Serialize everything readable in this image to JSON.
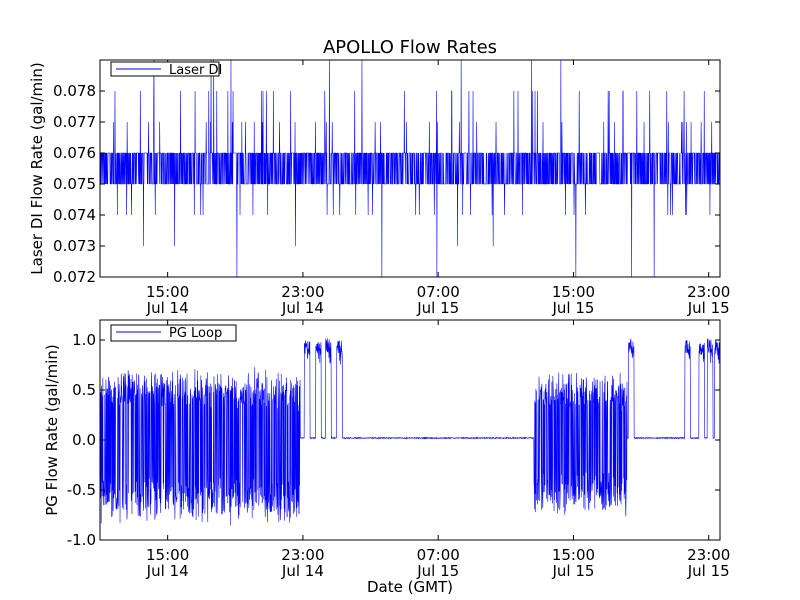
{
  "chart_data": [
    {
      "type": "line",
      "title": "APOLLO Flow Rates",
      "xlabel": "",
      "ylabel": "Laser DI Flow Rate (gal/min)",
      "x_range": [
        "2014-07-14 11:00",
        "2014-07-15 23:40"
      ],
      "ylim": [
        0.072,
        0.079
      ],
      "y_ticks": [
        0.072,
        0.073,
        0.074,
        0.075,
        0.076,
        0.077,
        0.078
      ],
      "y_tick_labels": [
        "0.072",
        "0.073",
        "0.074",
        "0.075",
        "0.076",
        "0.077",
        "0.078"
      ],
      "x_ticks": [
        {
          "value": "2014-07-14 15:00",
          "time": "15:00",
          "date": "Jul 14"
        },
        {
          "value": "2014-07-14 23:00",
          "time": "23:00",
          "date": "Jul 14"
        },
        {
          "value": "2014-07-15 07:00",
          "time": "07:00",
          "date": "Jul 15"
        },
        {
          "value": "2014-07-15 15:00",
          "time": "15:00",
          "date": "Jul 15"
        },
        {
          "value": "2014-07-15 23:00",
          "time": "23:00",
          "date": "Jul 15"
        }
      ],
      "legend_position": "top-left",
      "grid": false,
      "series": [
        {
          "name": "Laser DI",
          "color": "#0000ff",
          "base_range": [
            0.075,
            0.076
          ],
          "common_excursions": [
            0.074,
            0.077,
            0.078
          ],
          "rare_excursions": [
            0.072,
            0.073,
            0.079
          ]
        }
      ]
    },
    {
      "type": "line",
      "title": "",
      "xlabel": "Date (GMT)",
      "ylabel": "PG Flow Rate (gal/min)",
      "x_range": [
        "2014-07-14 11:00",
        "2014-07-15 23:40"
      ],
      "ylim": [
        -1.0,
        1.2
      ],
      "y_ticks": [
        -1.0,
        -0.5,
        0.0,
        0.5,
        1.0
      ],
      "y_tick_labels": [
        "-1.0",
        "-0.5",
        "0.0",
        "0.5",
        "1.0"
      ],
      "x_ticks": [
        {
          "value": "2014-07-14 15:00",
          "time": "15:00",
          "date": "Jul 14"
        },
        {
          "value": "2014-07-14 23:00",
          "time": "23:00",
          "date": "Jul 14"
        },
        {
          "value": "2014-07-15 07:00",
          "time": "07:00",
          "date": "Jul 15"
        },
        {
          "value": "2014-07-15 15:00",
          "time": "15:00",
          "date": "Jul 15"
        },
        {
          "value": "2014-07-15 23:00",
          "time": "23:00",
          "date": "Jul 15"
        }
      ],
      "legend_position": "top-left",
      "grid": false,
      "series": [
        {
          "name": "PG Loop",
          "color": "#0000ff",
          "oscillating_periods": [
            {
              "start": "2014-07-14 11:00",
              "end": "2014-07-14 22:50",
              "min": -0.9,
              "max": 0.75
            },
            {
              "start": "2014-07-15 12:40",
              "end": "2014-07-15 18:10",
              "min": -0.8,
              "max": 0.7
            }
          ],
          "idle_level": 0.02,
          "pulses": [
            {
              "start": "2014-07-14 23:05",
              "end": "2014-07-14 23:25",
              "peak": 1.0
            },
            {
              "start": "2014-07-14 23:45",
              "end": "2014-07-15 00:05",
              "peak": 0.98
            },
            {
              "start": "2014-07-15 00:20",
              "end": "2014-07-15 00:40",
              "peak": 1.02
            },
            {
              "start": "2014-07-15 01:00",
              "end": "2014-07-15 01:20",
              "peak": 1.0
            },
            {
              "start": "2014-07-15 18:15",
              "end": "2014-07-15 18:35",
              "peak": 1.02
            },
            {
              "start": "2014-07-15 21:35",
              "end": "2014-07-15 21:55",
              "peak": 1.0
            },
            {
              "start": "2014-07-15 22:25",
              "end": "2014-07-15 22:45",
              "peak": 1.0
            },
            {
              "start": "2014-07-15 22:55",
              "end": "2014-07-15 23:15",
              "peak": 1.02
            },
            {
              "start": "2014-07-15 23:20",
              "end": "2014-07-15 23:40",
              "peak": 1.0
            }
          ]
        }
      ]
    }
  ]
}
